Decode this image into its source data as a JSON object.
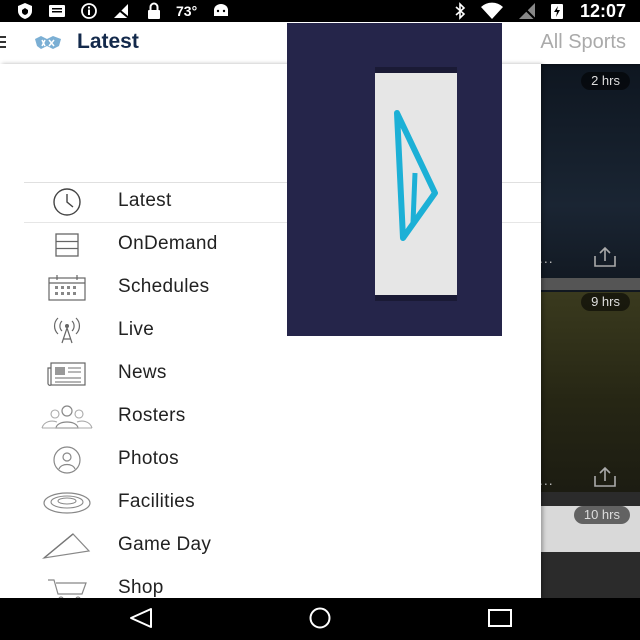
{
  "status_bar": {
    "temperature": "73°",
    "time": "12:07",
    "icons": [
      "shield-icon",
      "message-icon",
      "info-icon",
      "no-signal-icon",
      "lock-icon",
      "android-icon",
      "bluetooth-icon",
      "wifi-icon",
      "signal-icon",
      "battery-icon"
    ]
  },
  "app_bar": {
    "title": "Latest",
    "sport_selector": "All Sports",
    "icons": [
      "menu-icon",
      "team-logo-icon"
    ]
  },
  "drawer": {
    "items": [
      {
        "label": "Latest",
        "icon": "clock-icon"
      },
      {
        "label": "OnDemand",
        "icon": "stack-icon"
      },
      {
        "label": "Schedules",
        "icon": "calendar-icon"
      },
      {
        "label": "Live",
        "icon": "broadcast-icon"
      },
      {
        "label": "News",
        "icon": "newspaper-icon"
      },
      {
        "label": "Rosters",
        "icon": "group-icon"
      },
      {
        "label": "Photos",
        "icon": "person-icon"
      },
      {
        "label": "Facilities",
        "icon": "stadium-icon"
      },
      {
        "label": "Game Day",
        "icon": "pennant-icon"
      },
      {
        "label": "Shop",
        "icon": "cart-icon"
      }
    ]
  },
  "feed": {
    "cards": [
      {
        "time": "2 hrs"
      },
      {
        "time": "9 hrs"
      },
      {
        "time": "10 hrs"
      }
    ],
    "more_label": "...",
    "icons": [
      "share-icon"
    ]
  },
  "overlay": {
    "icon": "play-triangle-icon"
  },
  "nav_bar": {
    "icons": [
      "back-icon",
      "home-icon",
      "recents-icon"
    ]
  },
  "colors": {
    "brand": "#13294b",
    "accent": "#1cb0d6",
    "overlay_bg": "#25254a"
  }
}
